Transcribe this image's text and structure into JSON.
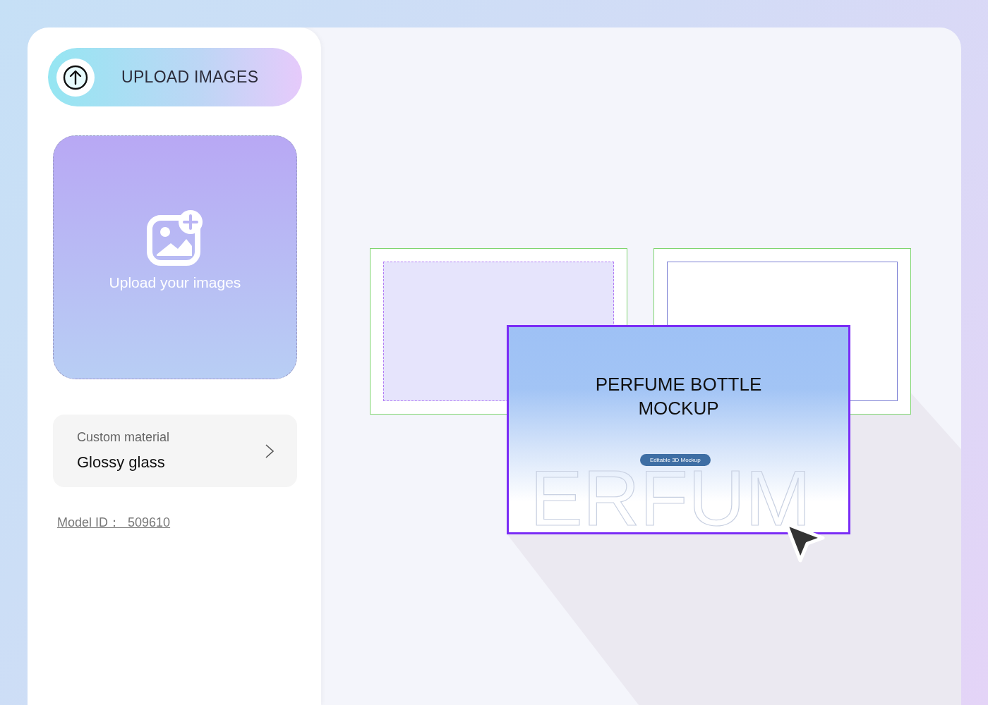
{
  "upload_button": {
    "label": "UPLOAD IMAGES"
  },
  "upload_zone": {
    "label": "Upload your images"
  },
  "material": {
    "label": "Custom material",
    "value": "Glossy glass"
  },
  "model_id": "Model ID：  509610",
  "canvas": {
    "frames": [
      {
        "kind": "dashed"
      },
      {
        "kind": "solid"
      }
    ],
    "mockup_card": {
      "title": "PERFUME BOTTLE MOCKUP",
      "watermark": "ERFUM",
      "badge": "Editable 3D Mockup"
    }
  }
}
